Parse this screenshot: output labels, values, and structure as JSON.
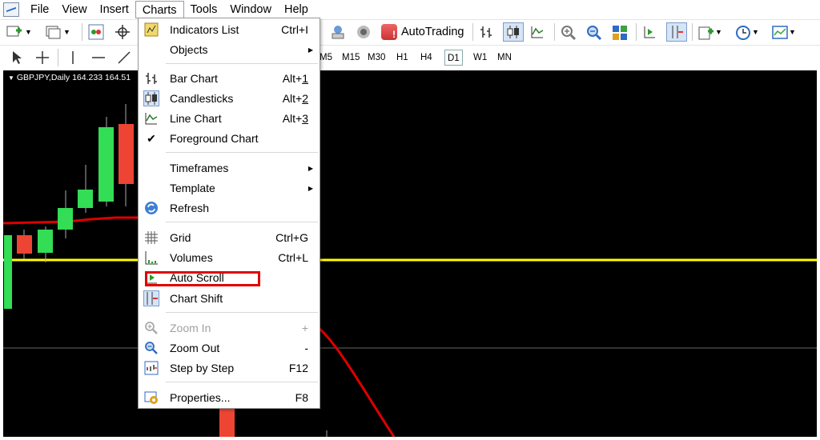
{
  "menubar": {
    "items": [
      "File",
      "View",
      "Insert",
      "Charts",
      "Tools",
      "Window",
      "Help"
    ],
    "active": "Charts"
  },
  "toolbar": {
    "autotrading_label": "AutoTrading",
    "timeframes": [
      "M5",
      "M15",
      "M30",
      "H1",
      "H4",
      "D1",
      "W1",
      "MN"
    ],
    "selected_timeframe": "D1"
  },
  "chart": {
    "title": "GBPJPY,Daily  164.233 164.51",
    "colors": {
      "background": "#000000",
      "bull": "#33dd55",
      "bear": "#ee4433",
      "ma": "#dd0000",
      "level": "#ffff00"
    }
  },
  "charts_menu": {
    "items": [
      {
        "label": "Indicators List",
        "shortcut": "Ctrl+I",
        "icon": "indicators-list-icon"
      },
      {
        "label": "Objects",
        "submenu": true
      },
      {
        "label": "Bar Chart",
        "shortcut_prefix": "Alt+",
        "shortcut_key": "1",
        "icon": "bar-chart-icon"
      },
      {
        "label": "Candlesticks",
        "shortcut_prefix": "Alt+",
        "shortcut_key": "2",
        "icon": "candlesticks-icon"
      },
      {
        "label": "Line Chart",
        "shortcut_prefix": "Alt+",
        "shortcut_key": "3",
        "icon": "line-chart-icon"
      },
      {
        "label": "Foreground Chart",
        "icon": "checkmark-icon",
        "check_glyph": "✔"
      },
      {
        "label": "Timeframes",
        "submenu": true
      },
      {
        "label": "Template",
        "submenu": true
      },
      {
        "label": "Refresh",
        "icon": "refresh-icon"
      },
      {
        "label": "Grid",
        "shortcut": "Ctrl+G",
        "icon": "grid-icon"
      },
      {
        "label": "Volumes",
        "shortcut": "Ctrl+L",
        "icon": "volumes-icon"
      },
      {
        "label": "Auto Scroll",
        "icon": "auto-scroll-icon"
      },
      {
        "label": "Chart Shift",
        "icon": "chart-shift-icon"
      },
      {
        "label": "Zoom In",
        "shortcut": "+",
        "icon": "zoom-in-icon",
        "disabled": true
      },
      {
        "label": "Zoom Out",
        "shortcut": "-",
        "icon": "zoom-out-icon"
      },
      {
        "label": "Step by Step",
        "shortcut": "F12",
        "icon": "step-by-step-icon"
      },
      {
        "label": "Properties...",
        "shortcut": "F8",
        "icon": "properties-icon"
      }
    ],
    "highlighted_item": "Auto Scroll",
    "highlight_color": "#e00000"
  }
}
